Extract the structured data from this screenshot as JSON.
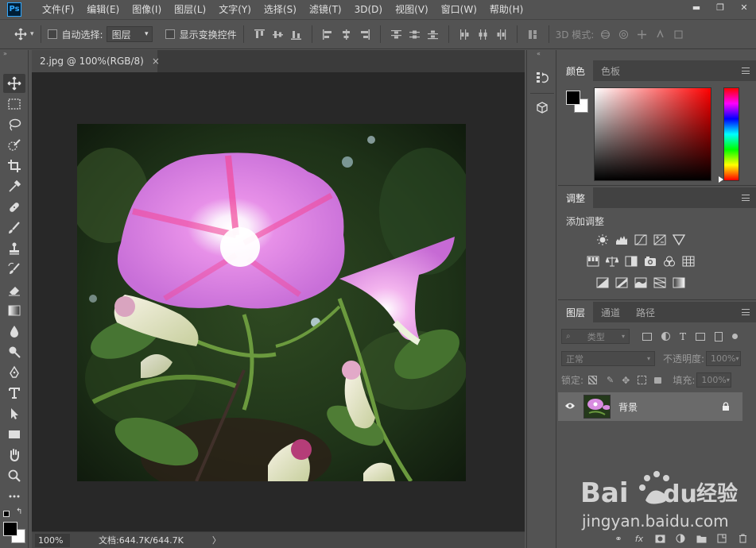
{
  "app": {
    "logo": "Ps"
  },
  "menu": [
    "文件(F)",
    "编辑(E)",
    "图像(I)",
    "图层(L)",
    "文字(Y)",
    "选择(S)",
    "滤镜(T)",
    "3D(D)",
    "视图(V)",
    "窗口(W)",
    "帮助(H)"
  ],
  "window_controls": {
    "minimize": "▬",
    "maximize": "❐",
    "close": "✕"
  },
  "options": {
    "auto_select_label": "自动选择:",
    "auto_select_target": "图层",
    "show_transform_label": "显示变换控件",
    "mode_3d_label": "3D 模式:"
  },
  "document": {
    "tab_title": "2.jpg @ 100%(RGB/8)",
    "close": "×"
  },
  "status": {
    "zoom": "100%",
    "doc_size": "文档:644.7K/644.7K",
    "arrow": "〉"
  },
  "color_panel": {
    "tabs": [
      "颜色",
      "色板"
    ],
    "foreground": "#000000",
    "background": "#ffffff"
  },
  "adjustments_panel": {
    "tabs": [
      "调整"
    ],
    "title": "添加调整"
  },
  "layers_panel": {
    "tabs": [
      "图层",
      "通道",
      "路径"
    ],
    "filter_kind": "类型",
    "blend_mode": "正常",
    "opacity_label": "不透明度:",
    "opacity_value": "100%",
    "lock_label": "锁定:",
    "fill_label": "填充:",
    "fill_value": "100%",
    "layers": [
      {
        "name": "背景",
        "visible": true,
        "locked": true
      }
    ],
    "footer_icons": [
      "link-icon",
      "fx-icon",
      "mask-icon",
      "adjustment-icon",
      "folder-icon",
      "new-layer-icon",
      "trash-icon"
    ]
  },
  "watermark": {
    "brand": "Bai du 经验",
    "url": "jingyan.baidu.com"
  }
}
